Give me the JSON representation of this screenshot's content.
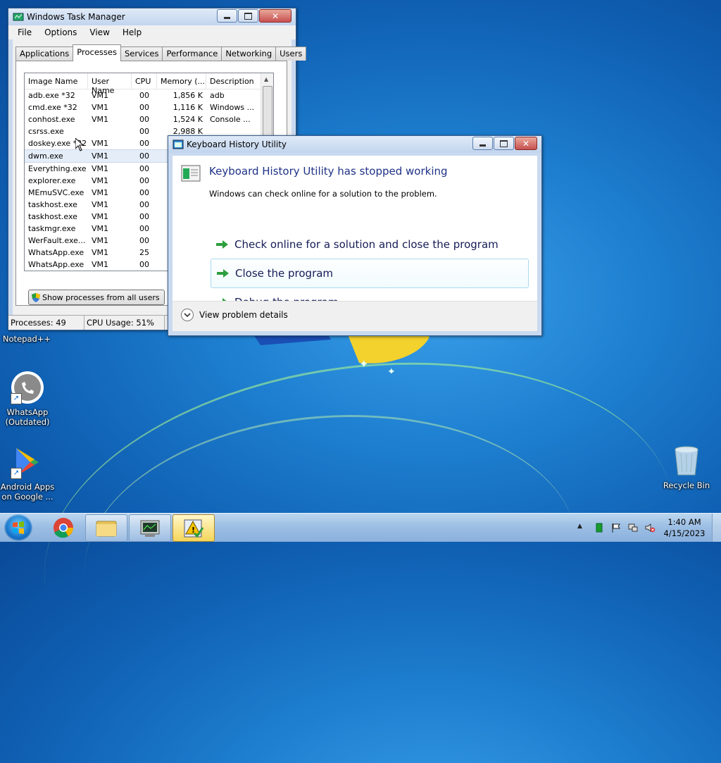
{
  "desktop": {
    "icons": [
      {
        "label": "Notepad++"
      },
      {
        "label": "WhatsApp (Outdated)"
      },
      {
        "label": "Android Apps on Google ..."
      },
      {
        "label": "Recycle Bin"
      }
    ]
  },
  "task_manager": {
    "title": "Windows Task Manager",
    "menu": [
      "File",
      "Options",
      "View",
      "Help"
    ],
    "tabs": [
      "Applications",
      "Processes",
      "Services",
      "Performance",
      "Networking",
      "Users"
    ],
    "active_tab": "Processes",
    "columns": [
      "Image Name",
      "User Name",
      "CPU",
      "Memory (...",
      "Description"
    ],
    "rows": [
      [
        "adb.exe *32",
        "VM1",
        "00",
        "1,856 K",
        "adb"
      ],
      [
        "cmd.exe *32",
        "VM1",
        "00",
        "1,116 K",
        "Windows ..."
      ],
      [
        "conhost.exe",
        "VM1",
        "00",
        "1,524 K",
        "Console ..."
      ],
      [
        "csrss.exe",
        "",
        "00",
        "2,988 K",
        ""
      ],
      [
        "doskey.exe *32",
        "VM1",
        "00",
        "",
        ""
      ],
      [
        "dwm.exe",
        "VM1",
        "00",
        "",
        ""
      ],
      [
        "Everything.exe",
        "VM1",
        "00",
        "",
        ""
      ],
      [
        "explorer.exe",
        "VM1",
        "00",
        "",
        ""
      ],
      [
        "MEmuSVC.exe",
        "VM1",
        "00",
        "",
        ""
      ],
      [
        "taskhost.exe",
        "VM1",
        "00",
        "",
        ""
      ],
      [
        "taskhost.exe",
        "VM1",
        "00",
        "",
        ""
      ],
      [
        "taskmgr.exe",
        "VM1",
        "00",
        "",
        ""
      ],
      [
        "WerFault.exe...",
        "VM1",
        "00",
        "",
        ""
      ],
      [
        "WhatsApp.exe",
        "VM1",
        "25",
        "",
        ""
      ],
      [
        "WhatsApp.exe",
        "VM1",
        "00",
        "",
        ""
      ]
    ],
    "show_all_button": "Show processes from all users",
    "status": {
      "processes": "Processes: 49",
      "cpu": "CPU Usage: 51%"
    }
  },
  "dialog": {
    "title": "Keyboard History Utility",
    "heading": "Keyboard History Utility has stopped working",
    "subtext": "Windows can check online for a solution to the problem.",
    "options": [
      "Check online for a solution and close the program",
      "Close the program",
      "Debug the program"
    ],
    "details_label": "View problem details"
  },
  "taskbar": {
    "clock_time": "1:40 AM",
    "clock_date": "4/15/2023"
  }
}
